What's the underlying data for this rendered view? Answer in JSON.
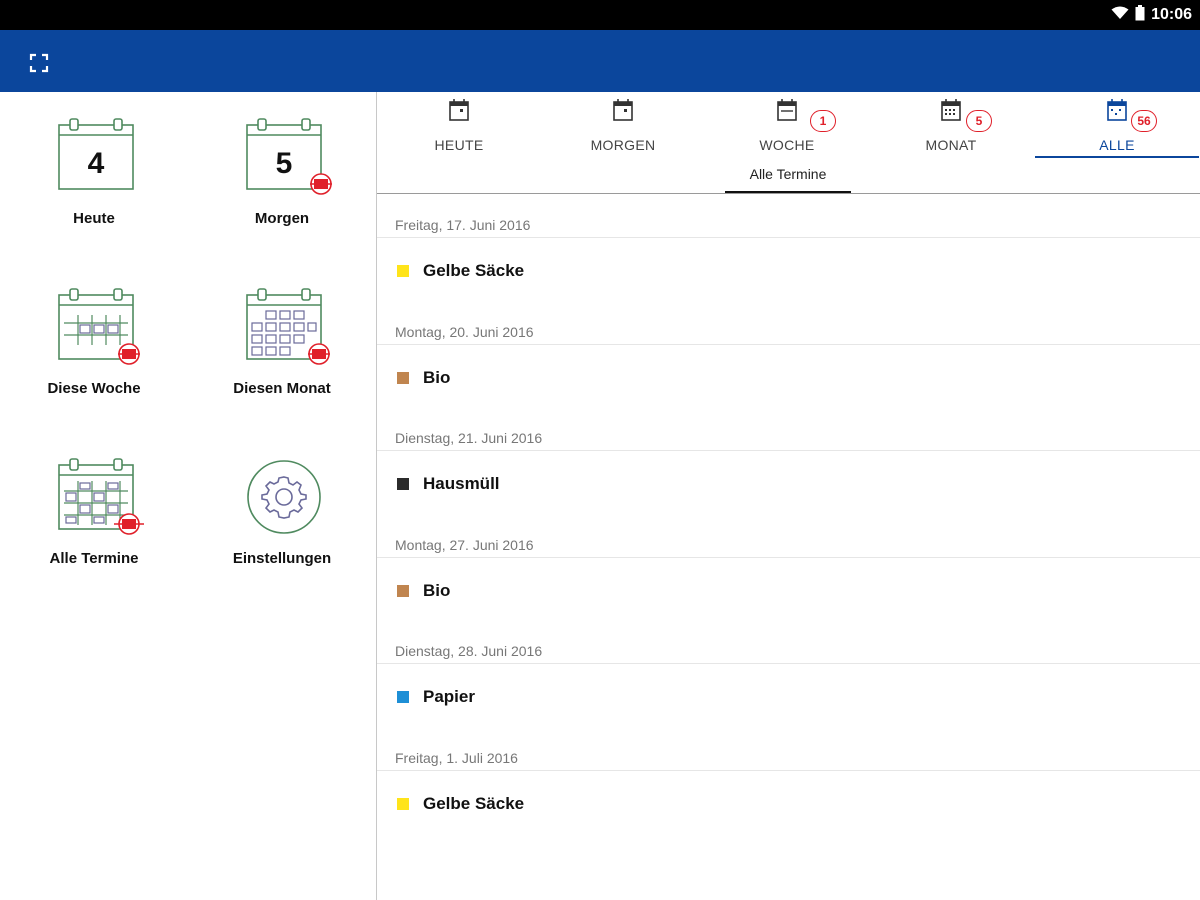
{
  "status": {
    "time": "10:06"
  },
  "tiles": [
    {
      "label": "Heute",
      "day": "4"
    },
    {
      "label": "Morgen",
      "day": "5"
    },
    {
      "label": "Diese Woche"
    },
    {
      "label": "Diesen Monat"
    },
    {
      "label": "Alle Termine"
    },
    {
      "label": "Einstellungen"
    }
  ],
  "tabs": [
    {
      "label": "HEUTE"
    },
    {
      "label": "MORGEN"
    },
    {
      "label": "WOCHE",
      "badge": "1"
    },
    {
      "label": "MONAT",
      "badge": "5"
    },
    {
      "label": "ALLE",
      "badge": "56"
    }
  ],
  "subtab": {
    "label": "Alle Termine"
  },
  "events": [
    {
      "date": "Freitag, 17. Juni 2016",
      "type": "Gelbe Säcke",
      "color": "#ffe41a"
    },
    {
      "date": "Montag, 20. Juni 2016",
      "type": "Bio",
      "color": "#c0854f"
    },
    {
      "date": "Dienstag, 21. Juni 2016",
      "type": "Hausmüll",
      "color": "#2b2b2b"
    },
    {
      "date": "Montag, 27. Juni 2016",
      "type": "Bio",
      "color": "#c0854f"
    },
    {
      "date": "Dienstag, 28. Juni 2016",
      "type": "Papier",
      "color": "#1e8fd6"
    },
    {
      "date": "Freitag, 1. Juli 2016",
      "type": "Gelbe Säcke",
      "color": "#ffe41a"
    }
  ],
  "colors": {
    "primary": "#0b469c",
    "badge": "#e0202a",
    "calendar_green": "#4f8a5f"
  }
}
